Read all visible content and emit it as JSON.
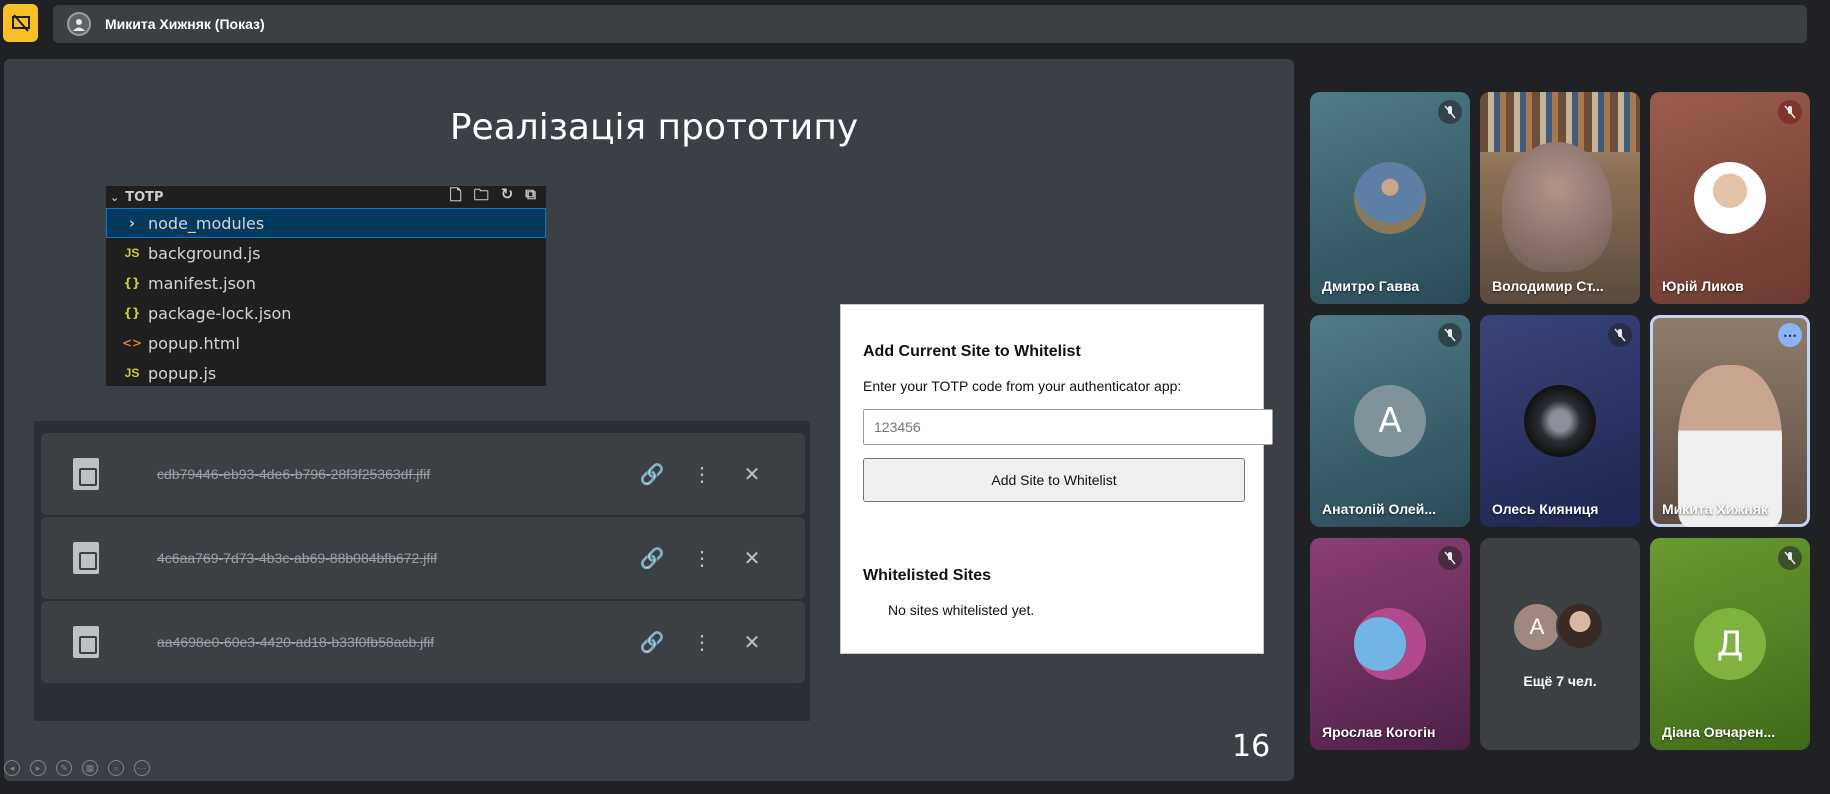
{
  "topbar": {
    "presenter_title": "Микита Хижняк (Показ)"
  },
  "slide": {
    "title": "Реалізація прототипу",
    "number": "16",
    "explorer": {
      "folder": "TOTP",
      "files": [
        {
          "name": "node_modules",
          "icon": "folder-chevron",
          "glyph": "›",
          "selected": true
        },
        {
          "name": "background.js",
          "icon": "js-file-icon",
          "glyph": "JS"
        },
        {
          "name": "manifest.json",
          "icon": "json-file-icon",
          "glyph": "{}"
        },
        {
          "name": "package-lock.json",
          "icon": "json-file-icon",
          "glyph": "{}"
        },
        {
          "name": "popup.html",
          "icon": "html-file-icon",
          "glyph": "<>"
        },
        {
          "name": "popup.js",
          "icon": "js-file-icon",
          "glyph": "JS"
        }
      ]
    },
    "uploads": [
      {
        "name": "cdb79446-eb93-4de6-b796-28f3f25363df.jfif"
      },
      {
        "name": "4c6aa769-7d73-4b3c-ab69-88b084bfb672.jfif"
      },
      {
        "name": "aa4698e0-60e3-4420-ad18-b33f0fb58acb.jfif"
      }
    ],
    "popup": {
      "heading": "Add Current Site to Whitelist",
      "label": "Enter your TOTP code from your authenticator app:",
      "input_placeholder": "123456",
      "button_label": "Add Site to Whitelist",
      "list_heading": "Whitelisted Sites",
      "empty_text": "No sites whitelisted yet."
    }
  },
  "participants": [
    {
      "name": "Дмитро Гавва",
      "muted": true
    },
    {
      "name": "Володимир Ст...",
      "muted": false
    },
    {
      "name": "Юрій Ликов",
      "muted": true
    },
    {
      "name": "Анатолій Олей...",
      "muted": true,
      "initial": "A"
    },
    {
      "name": "Олесь Кияниця",
      "muted": true
    },
    {
      "name": "Микита Хижняк",
      "muted": false
    },
    {
      "name": "Ярослав Когогін",
      "muted": true
    },
    {
      "others_label": "Ещё 7 чел.",
      "initial": "A"
    },
    {
      "name": "Діана Овчарен...",
      "muted": true,
      "initial": "Д"
    }
  ],
  "colors": {
    "present_badge": "#f6c026",
    "slide_bg": "#3b3f46",
    "vscode_selection": "#04395e",
    "active_speaker_outline": "#c3d4f0"
  }
}
